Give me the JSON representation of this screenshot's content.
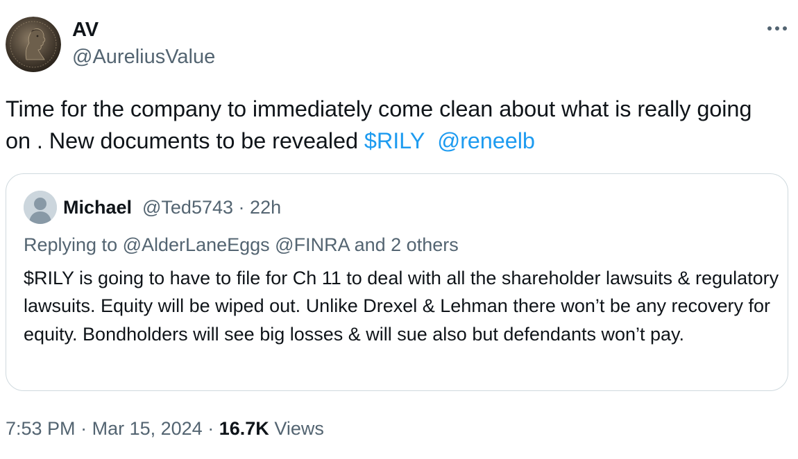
{
  "author": {
    "name": "AV",
    "handle": "@AureliusValue",
    "avatar_icon": "roman-coin-avatar-icon"
  },
  "tweet": {
    "text_before": "Time for the company to immediately come clean about what is really going on . New documents to be revealed ",
    "cashtag": "$RILY",
    "mention": "@reneelb"
  },
  "quoted": {
    "name": "Michael",
    "handle": "@Ted5743",
    "separator": "·",
    "time": "22h",
    "replying_to_label": "Replying to",
    "replying_to_1": "@AlderLaneEggs",
    "replying_to_2": "@FINRA",
    "replying_to_more": "and 2 others",
    "text": "$RILY is going to have to file for Ch 11 to deal with all the shareholder lawsuits & regulatory lawsuits. Equity will be wiped out. Unlike Drexel & Lehman there won’t be any recovery for equity. Bondholders will see big losses & will sue also but defendants won’t pay."
  },
  "footer": {
    "time": "7:53 PM",
    "sep1": "·",
    "date": "Mar 15, 2024",
    "sep2": "·",
    "views_count": "16.7K",
    "views_label": "Views"
  },
  "colors": {
    "link": "#1d9bf0",
    "secondary_text": "#536471",
    "border": "#cfd9de"
  }
}
